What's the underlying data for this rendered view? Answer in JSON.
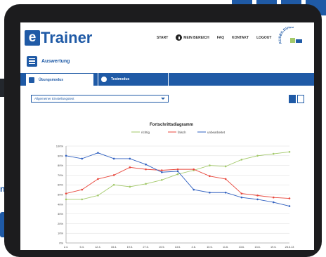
{
  "header": {
    "logo_e": "e",
    "logo_rest": "Trainer",
    "nav": [
      "START",
      "MEIN BEREICH",
      "FAQ",
      "KONTAKT",
      "LOGOUT"
    ],
    "badge_text": "AUSBILDUNG"
  },
  "section": {
    "title": "Auswertung"
  },
  "tabs": [
    {
      "label": "Übungsmodus",
      "active": true
    },
    {
      "label": "Testmodus",
      "active": false
    }
  ],
  "dropdown": {
    "value": "Allgemeiner Einstellungstest"
  },
  "colors": {
    "primary": "#1f5aa6",
    "richtig": "#a3c96a",
    "falsch": "#e8473c",
    "unbearbeitet": "#3060c0"
  },
  "chart_data": {
    "type": "line",
    "title": "Fortschrittsdiagramm",
    "categories": [
      "2.4.",
      "5.4.",
      "12.4.",
      "15.4.",
      "19.5.",
      "27.5.",
      "10.5.",
      "13.5.",
      "4.6.",
      "10.6.",
      "11.6.",
      "13.6.",
      "13.6.",
      "19.6.",
      "28.6.13"
    ],
    "yticks": [
      "100%",
      "90%",
      "80%",
      "70%",
      "60%",
      "50%",
      "40%",
      "30%",
      "20%",
      "10%",
      "0%"
    ],
    "ylim": [
      0,
      100
    ],
    "legend_position": "top",
    "series": [
      {
        "name": "richtig",
        "values": [
          45,
          45,
          49,
          60,
          58,
          61,
          65,
          71,
          75,
          80,
          79,
          86,
          90,
          92,
          94
        ]
      },
      {
        "name": "falsch",
        "values": [
          51,
          55,
          66,
          70,
          78,
          76,
          75,
          76,
          76,
          69,
          66,
          51,
          49,
          47,
          46
        ]
      },
      {
        "name": "unbearbeitet",
        "values": [
          90,
          87,
          93,
          87,
          87,
          81,
          73,
          74,
          55,
          52,
          52,
          47,
          45,
          42,
          38
        ]
      }
    ]
  }
}
